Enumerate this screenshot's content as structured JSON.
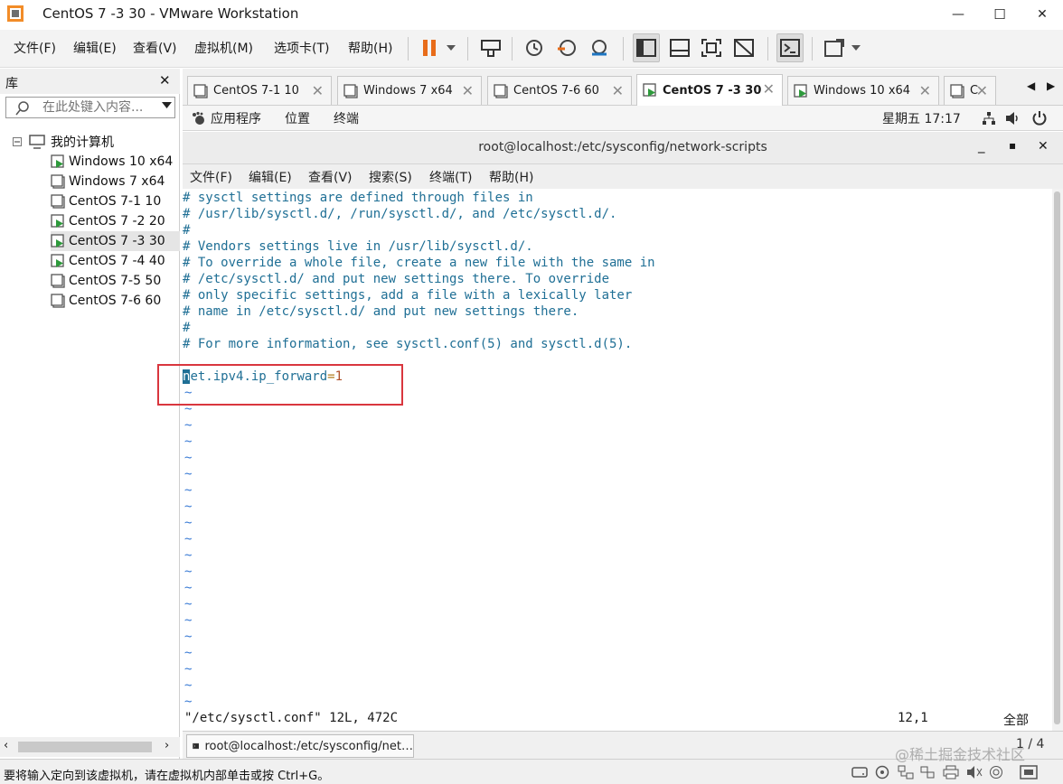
{
  "window": {
    "title": "CentOS 7 -3 30 - VMware Workstation",
    "controls": {
      "minimize": "—",
      "maximize": "☐",
      "close": "✕"
    }
  },
  "menu": [
    {
      "label": "文件(F)"
    },
    {
      "label": "编辑(E)"
    },
    {
      "label": "查看(V)"
    },
    {
      "label": "虚拟机(M)"
    },
    {
      "label": "选项卡(T)"
    },
    {
      "label": "帮助(H)"
    }
  ],
  "toolbar": {
    "icons": [
      "pause-icon",
      "send-ctrl-alt-del-icon",
      "snapshot-icon",
      "revert-snapshot-icon",
      "snapshot-manager-icon",
      "view-library-icon",
      "view-thumbnail-icon",
      "fullscreen-icon",
      "unity-icon",
      "console-icon",
      "stretch-icon"
    ],
    "accent": "#e86c1a"
  },
  "library": {
    "title": "库",
    "close": "✕",
    "search_placeholder": "在此处键入内容...",
    "root": "我的计算机",
    "items": [
      {
        "label": "Windows 10 x64",
        "running": true
      },
      {
        "label": "Windows 7 x64",
        "running": false
      },
      {
        "label": "CentOS 7-1  10",
        "running": false
      },
      {
        "label": "CentOS 7 -2 20",
        "running": true
      },
      {
        "label": "CentOS 7 -3 30",
        "running": true,
        "selected": true
      },
      {
        "label": "CentOS 7 -4 40",
        "running": true
      },
      {
        "label": "CentOS 7-5 50",
        "running": false
      },
      {
        "label": "CentOS 7-6  60",
        "running": false
      }
    ]
  },
  "tabs": [
    {
      "label": "CentOS 7-1  10",
      "running": false
    },
    {
      "label": "Windows 7 x64",
      "running": false
    },
    {
      "label": "CentOS 7-6  60",
      "running": false
    },
    {
      "label": "CentOS 7 -3 30",
      "running": true,
      "active": true
    },
    {
      "label": "Windows 10 x64",
      "running": true
    },
    {
      "label": "C",
      "running": false
    }
  ],
  "gnome": {
    "apps": "应用程序",
    "places": "位置",
    "terminal": "终端",
    "clock": "星期五 17:17"
  },
  "terminal": {
    "title": "root@localhost:/etc/sysconfig/network-scripts",
    "menu": [
      "文件(F)",
      "编辑(E)",
      "查看(V)",
      "搜索(S)",
      "终端(T)",
      "帮助(H)"
    ],
    "controls": {
      "minimize": "_",
      "maximize": "▪",
      "close": "✕"
    },
    "lines": [
      "# sysctl settings are defined through files in",
      "# /usr/lib/sysctl.d/, /run/sysctl.d/, and /etc/sysctl.d/.",
      "#",
      "# Vendors settings live in /usr/lib/sysctl.d/.",
      "# To override a whole file, create a new file with the same in",
      "# /etc/sysctl.d/ and put new settings there. To override",
      "# only specific settings, add a file with a lexically later",
      "# name in /etc/sysctl.d/ and put new settings there.",
      "#",
      "# For more information, see sysctl.conf(5) and sysctl.d(5)."
    ],
    "setting": {
      "cursor_char": "n",
      "key": "et.ipv4.ip_forward",
      "eq": "=",
      "value": "1"
    },
    "tilde": "~",
    "status_file": "\"/etc/sysctl.conf\" 12L, 472C",
    "status_pos": "12,1",
    "status_all": "全部"
  },
  "vm_taskbar": {
    "task": "root@localhost:/etc/sysconfig/net…",
    "pager": "1 / 4"
  },
  "statusbar": {
    "text": "要将输入定向到该虚拟机，请在虚拟机内部单击或按 Ctrl+G。",
    "watermark": "@稀土掘金技术社区"
  }
}
